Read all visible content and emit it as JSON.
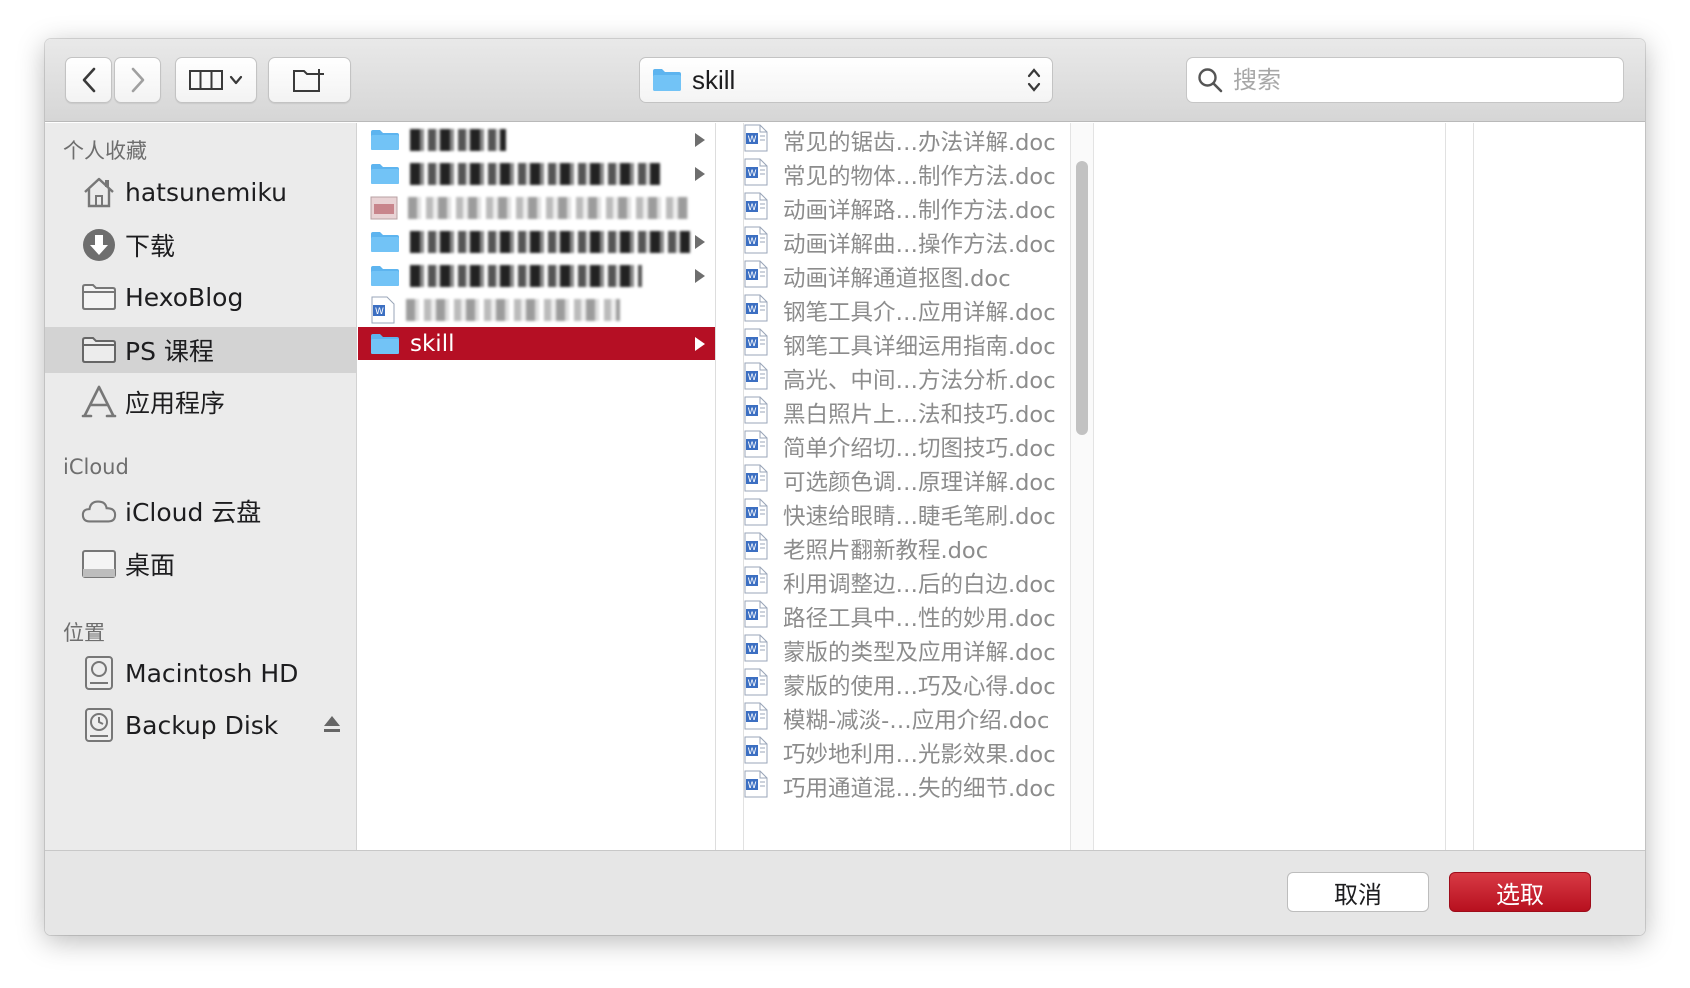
{
  "toolbar": {
    "path_label": "skill",
    "search_placeholder": "搜索"
  },
  "sidebar": {
    "favorites_heading": "个人收藏",
    "favorites": [
      {
        "label": "hatsunemiku",
        "icon": "home-icon"
      },
      {
        "label": "下载",
        "icon": "download-icon"
      },
      {
        "label": "HexoBlog",
        "icon": "folder-icon"
      },
      {
        "label": "PS 课程",
        "icon": "folder-icon",
        "selected": true
      },
      {
        "label": "应用程序",
        "icon": "applications-icon"
      }
    ],
    "icloud_heading": "iCloud",
    "icloud": [
      {
        "label": "iCloud 云盘",
        "icon": "cloud-icon"
      },
      {
        "label": "桌面",
        "icon": "desktop-icon"
      }
    ],
    "locations_heading": "位置",
    "locations": [
      {
        "label": "Macintosh HD",
        "icon": "hard-drive-icon"
      },
      {
        "label": "Backup Disk",
        "icon": "time-machine-disk-icon"
      }
    ]
  },
  "column1": {
    "selected_label": "skill"
  },
  "files": [
    "常见的锯齿…办法详解.doc",
    "常见的物体…制作方法.doc",
    "动画详解路…制作方法.doc",
    "动画详解曲…操作方法.doc",
    "动画详解通道抠图.doc",
    "钢笔工具介…应用详解.doc",
    "钢笔工具详细运用指南.doc",
    "高光、中间…方法分析.doc",
    "黑白照片上…法和技巧.doc",
    "简单介绍切…切图技巧.doc",
    "可选颜色调…原理详解.doc",
    "快速给眼睛…睫毛笔刷.doc",
    "老照片翻新教程.doc",
    "利用调整边…后的白边.doc",
    "路径工具中…性的妙用.doc",
    "蒙版的类型及应用详解.doc",
    "蒙版的使用…巧及心得.doc",
    "模糊-减淡-…应用介绍.doc",
    "巧妙地利用…光影效果.doc",
    "巧用通道混…失的细节.doc"
  ],
  "buttons": {
    "cancel": "取消",
    "choose": "选取"
  },
  "colors": {
    "accent": "#b50f24",
    "folder_blue": "#5db4ef"
  }
}
